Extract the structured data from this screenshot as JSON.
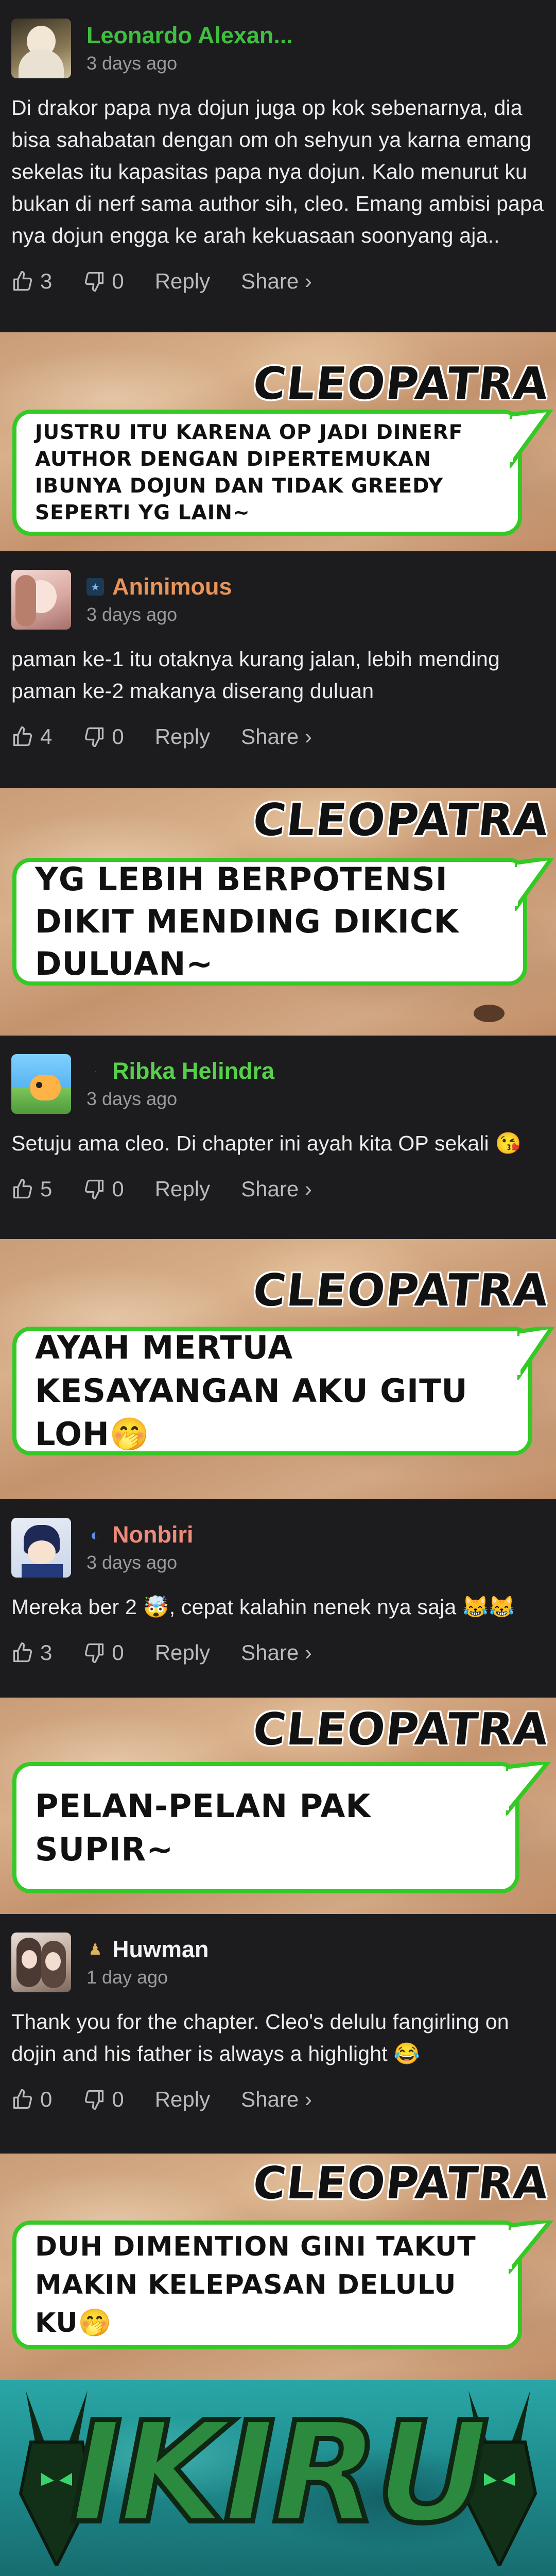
{
  "comments": [
    {
      "username": "Leonardo Alexan...",
      "name_color": "#3fbf3f",
      "time": "3 days ago",
      "text": "Di drakor papa nya dojun juga op kok sebenarnya, dia bisa sahabatan dengan om oh sehyun ya karna emang sekelas itu kapasitas papa nya dojun. Kalo menurut ku bukan di nerf sama author sih, cleo. Emang ambisi papa nya dojun engga ke arah kekuasaan soonyang aja..",
      "likes": "3",
      "dislikes": "0",
      "reply": "Reply",
      "share": "Share ›"
    },
    {
      "username": "Aninimous",
      "name_color": "#e8945a",
      "time": "3 days ago",
      "text": "paman ke-1 itu otaknya kurang jalan, lebih mending paman ke-2 makanya diserang duluan",
      "likes": "4",
      "dislikes": "0",
      "reply": "Reply",
      "share": "Share ›"
    },
    {
      "username": "Ribka Helindra",
      "name_color": "#56d04a",
      "time": "3 days ago",
      "text": "Setuju ama cleo. Di chapter ini ayah kita OP sekali 😘",
      "likes": "5",
      "dislikes": "0",
      "reply": "Reply",
      "share": "Share ›"
    },
    {
      "username": "Nonbiri",
      "name_color": "#f08a7a",
      "time": "3 days ago",
      "text": "Mereka ber 2 🤯, cepat kalahin nenek nya saja 😹😹",
      "likes": "3",
      "dislikes": "0",
      "reply": "Reply",
      "share": "Share ›"
    },
    {
      "username": "Huwman",
      "name_color": "#f2f2f2",
      "time": "1 day ago",
      "text": "Thank you for the chapter. Cleo's delulu fangirling on dojin and his father is always a highlight 😂",
      "likes": "0",
      "dislikes": "0",
      "reply": "Reply",
      "share": "Share ›"
    }
  ],
  "panels": [
    {
      "speaker": "CLEOPATRA",
      "text": "JUSTRU ITU KARENA OP JADI DINERF AUTHOR DENGAN DIPERTEMUKAN IBUNYA DOJUN DAN TIDAK GREEDY SEPERTI YG LAIN~"
    },
    {
      "speaker": "CLEOPATRA",
      "text": "YG LEBIH BERPOTENSI DIKIT MENDING DIKICK DULUAN~"
    },
    {
      "speaker": "CLEOPATRA",
      "text": "AYAH MERTUA KESAYANGAN AKU GITU LOH🤭"
    },
    {
      "speaker": "CLEOPATRA",
      "text": "PELAN-PELAN PAK SUPIR~"
    },
    {
      "speaker": "CLEOPATRA",
      "text": "DUH DIMENTION GINI TAKUT MAKIN KELEPASAN DELULU KU🤭"
    }
  ],
  "footer": {
    "logo_text": "IKIRU"
  },
  "icons": {
    "like": "thumbs-up-icon",
    "dislike": "thumbs-down-icon",
    "badge": "user-badge-icon"
  },
  "colors": {
    "background": "#1c1c1e",
    "bubble_border": "#34c924",
    "footer_teal": "#1e8a8c",
    "logo_green": "#2c8a3e"
  }
}
